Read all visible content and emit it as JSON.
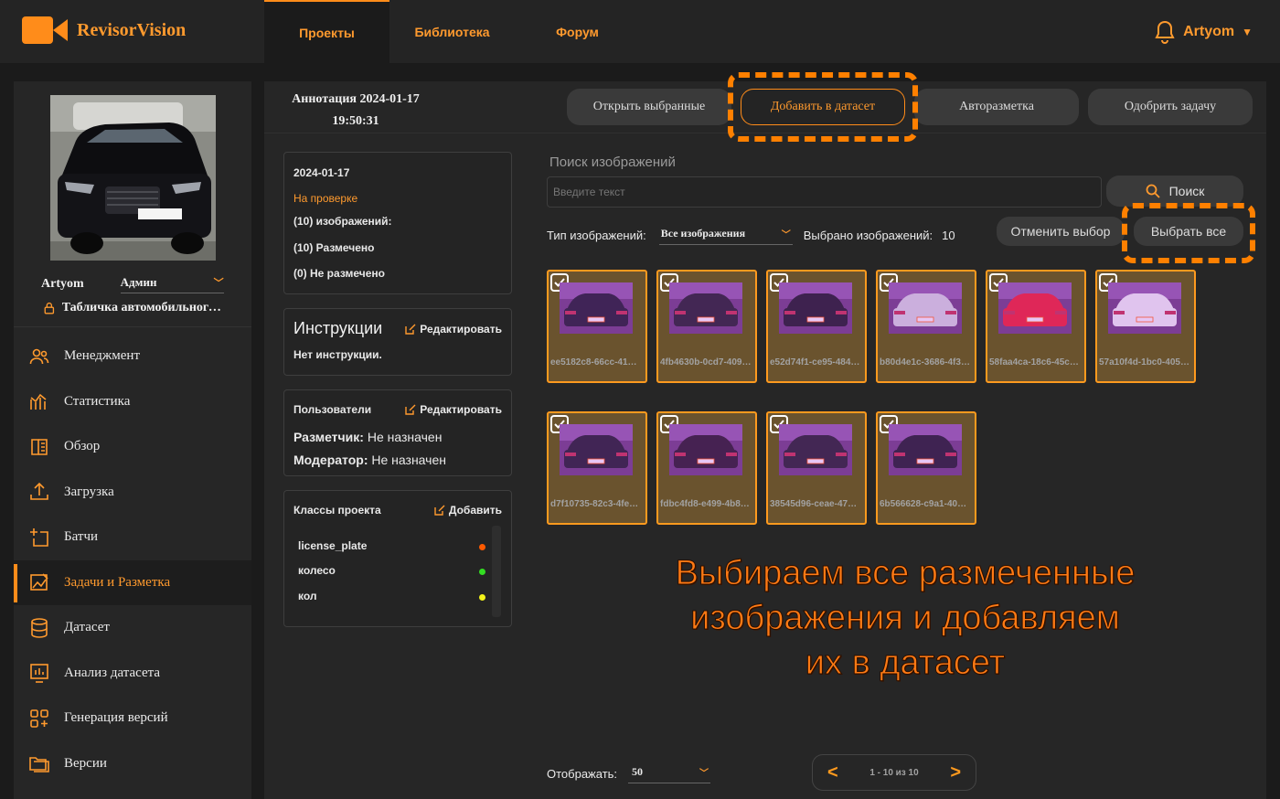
{
  "app": {
    "name": "RevisorVision"
  },
  "nav": {
    "tabs": [
      {
        "label": "Проекты"
      },
      {
        "label": "Библиотека"
      },
      {
        "label": "Форум"
      }
    ]
  },
  "header": {
    "user": "Artyom"
  },
  "sidebar": {
    "username": "Artyom",
    "role": "Админ",
    "project": "Табличка автомобильного номера",
    "items": [
      {
        "label": "Менеджмент",
        "icon": "users-icon"
      },
      {
        "label": "Статистика",
        "icon": "chart-icon"
      },
      {
        "label": "Обзор",
        "icon": "book-icon"
      },
      {
        "label": "Загрузка",
        "icon": "upload-icon"
      },
      {
        "label": "Батчи",
        "icon": "batch-add-icon"
      },
      {
        "label": "Задачи и Разметка",
        "icon": "annotate-icon"
      },
      {
        "label": "Датасет",
        "icon": "database-icon"
      },
      {
        "label": "Анализ датасета",
        "icon": "analysis-icon"
      },
      {
        "label": "Генерация версий",
        "icon": "grid-plus-icon"
      },
      {
        "label": "Версии",
        "icon": "folders-icon"
      }
    ]
  },
  "task": {
    "title_line1": "Аннотация 2024-01-17",
    "title_line2": "19:50:31",
    "actions": {
      "open": "Открыть выбранные",
      "add": "Добавить в датасет",
      "auto": "Авторазметка",
      "approve": "Одобрить задачу"
    }
  },
  "info": {
    "date": "2024-01-17",
    "status": "На проверке",
    "images": "(10) изображений:",
    "labeled": "(10) Размечено",
    "unlabeled": "(0) Не размечено"
  },
  "instructions": {
    "title": "Инструкции",
    "edit": "Редактировать",
    "text": "Нет инструкции."
  },
  "users": {
    "title": "Пользователи",
    "edit": "Редактировать",
    "annotator_label": "Разметчик:",
    "annotator_value": "Не назначен",
    "moderator_label": "Модератор:",
    "moderator_value": "Не назначен"
  },
  "classes": {
    "title": "Классы проекта",
    "add": "Добавить",
    "items": [
      {
        "name": "license_plate",
        "color": "#ff5a00"
      },
      {
        "name": "колесо",
        "color": "#33dd22"
      },
      {
        "name": "кол",
        "color": "#f2f21a"
      }
    ]
  },
  "search": {
    "label": "Поиск изображений",
    "placeholder": "Введите текст",
    "button": "Поиск"
  },
  "filter": {
    "type_label": "Тип изображений:",
    "type_value": "Все изображения",
    "selected_label": "Выбрано изображений:",
    "selected_count": "10",
    "clear_button": "Отменить выбор",
    "select_all_button": "Выбрать все"
  },
  "images": [
    {
      "name": "ee5182c8-66cc-41…",
      "car": "#1d1d28"
    },
    {
      "name": "4fb4630b-0cd7-409…",
      "car": "#202024"
    },
    {
      "name": "e52d74f1-ce95-484…",
      "car": "#1a1a1e"
    },
    {
      "name": "b80d4e1c-3686-4f3…",
      "car": "#cfcfd4"
    },
    {
      "name": "58faa4ca-18c6-45c…",
      "car": "#e8202a"
    },
    {
      "name": "57a10f4d-1bc0-405…",
      "car": "#eaeaea"
    },
    {
      "name": "d7f10735-82c3-4fe…",
      "car": "#1e1e26"
    },
    {
      "name": "fdbc4fd8-e499-4b8…",
      "car": "#241a22"
    },
    {
      "name": "38545d96-ceae-47…",
      "car": "#202024"
    },
    {
      "name": "6b566628-c9a1-40…",
      "car": "#1c1c22"
    }
  ],
  "overlay": {
    "line1": "Выбираем все размеченные",
    "line2": "изображения и добавляем",
    "line3": "их в датасет"
  },
  "pagination": {
    "show_label": "Отображать:",
    "per_page": "50",
    "info": "1 - 10 из 10"
  },
  "colors": {
    "accent": "#ff8c1a",
    "panel": "#262626",
    "bg": "#1b1b1b"
  }
}
